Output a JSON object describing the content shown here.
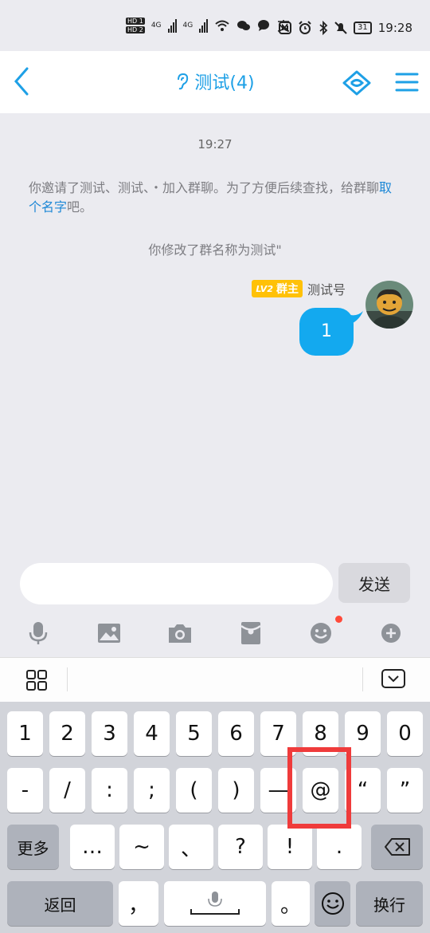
{
  "status_bar": {
    "hd1": "HD 1",
    "hd2": "HD 2",
    "net1": "4G",
    "net2": "4G",
    "time": "19:28",
    "battery": "31"
  },
  "header": {
    "title": "测试(4)"
  },
  "chat": {
    "timestamp": "19:27",
    "system_message_prefix": "你邀请了测试、测试、・加入群聊。为了方便后续查找，给群聊",
    "system_message_link": "取个名字",
    "system_message_suffix": "吧。",
    "rename_notice": "你修改了群名称为测试\"",
    "sender": {
      "level": "LV2",
      "role": "群主",
      "name": "测试号"
    },
    "message_text": "1"
  },
  "composer": {
    "input_value": "",
    "send_label": "发送"
  },
  "keyboard": {
    "row1": [
      "1",
      "2",
      "3",
      "4",
      "5",
      "6",
      "7",
      "8",
      "9",
      "0"
    ],
    "row2": [
      "-",
      "/",
      ":",
      ";",
      "(",
      ")",
      "—",
      "@",
      "“",
      "”"
    ],
    "row3": [
      "更多",
      "…",
      "~",
      "、",
      "?",
      "!",
      "."
    ],
    "row4": [
      "返回",
      "，",
      "",
      "。",
      "",
      "换行"
    ]
  },
  "colors": {
    "accent": "#1ea0e6",
    "bubble": "#13a9ef",
    "highlight": "#ef3b3b",
    "badge": "#ffc107"
  }
}
